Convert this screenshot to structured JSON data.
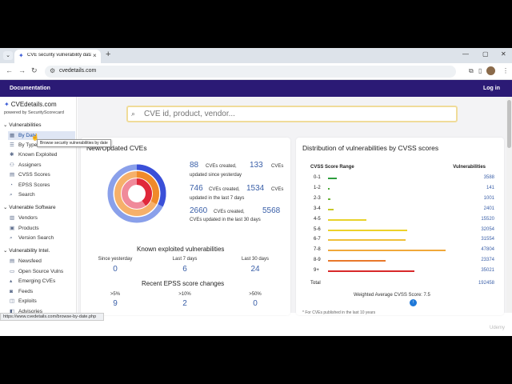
{
  "browser": {
    "tab_title": "CVE security vulnerability datab",
    "url": "cvedetails.com",
    "menu_chevron": "⌄",
    "new_tab": "+",
    "close": "×",
    "minimize": "—",
    "maximize": "▢",
    "win_close": "✕"
  },
  "nav": {
    "documentation": "Documentation",
    "login": "Log in"
  },
  "sidebar": {
    "logo": "CVEdetails.com",
    "powered": "powered by SecurityScorecard",
    "sections": [
      {
        "label": "Vulnerabilities",
        "items": [
          "By Date",
          "By Type",
          "Known Exploited",
          "Assigners",
          "CVSS Scores",
          "EPSS Scores",
          "Search"
        ]
      },
      {
        "label": "Vulnerable Software",
        "items": [
          "Vendors",
          "Products",
          "Version Search"
        ]
      },
      {
        "label": "Vulnerability Intel.",
        "items": [
          "Newsfeed",
          "Open Source Vulns",
          "Emerging CVEs",
          "Feeds",
          "Exploits",
          "Advisories"
        ]
      }
    ],
    "tooltip": "Browse security vulnerabilities by date",
    "status_url": "https://www.cvedetails.com/browse-by-date.php"
  },
  "search": {
    "placeholder": "CVE id, product, vendor..."
  },
  "new_cves": {
    "title": "New/Updated CVEs",
    "rows": [
      {
        "created": "88",
        "mid": "CVEs created,",
        "updated": "133",
        "end": "CVEs",
        "caption": "updated since yesterday"
      },
      {
        "created": "746",
        "mid": "CVEs created,",
        "updated": "1534",
        "end": "CVEs",
        "caption": "updated in the last 7 days"
      },
      {
        "created": "2660",
        "mid": "CVEs created,",
        "updated": "5568",
        "end": "",
        "caption": "CVEs updated in the last 30 days"
      }
    ],
    "donut": {
      "rings": [
        {
          "name": "outer",
          "created": 2660,
          "updated": 5568
        },
        {
          "name": "middle",
          "created": 746,
          "updated": 1534
        },
        {
          "name": "inner",
          "created": 88,
          "updated": 133
        }
      ],
      "colors": {
        "outer_a": "#3a4fd8",
        "outer_b": "#8aa0ea",
        "mid_a": "#f08a2a",
        "mid_b": "#f6b06a",
        "inner_a": "#e0283a",
        "inner_b": "#f08a9a"
      }
    },
    "known_exploited_title": "Known exploited vulnerabilities",
    "known_exploited": [
      {
        "label": "Since yesterday",
        "value": "0"
      },
      {
        "label": "Last 7 days",
        "value": "6"
      },
      {
        "label": "Last 30 days",
        "value": "24"
      }
    ],
    "epss_title": "Recent EPSS score changes",
    "epss": [
      {
        "label": ">5%",
        "value": "9"
      },
      {
        "label": ">10%",
        "value": "2"
      },
      {
        "label": ">50%",
        "value": "0"
      }
    ]
  },
  "cvss": {
    "title": "Distribution of vulnerabilities by CVSS scores",
    "header_range": "CVSS Score Range",
    "header_vulns": "Vulnerabilities",
    "rows": [
      {
        "range": "0-1",
        "value": "3588",
        "n": 3588,
        "color": "#2e9e3e"
      },
      {
        "range": "1-2",
        "value": "141",
        "n": 141,
        "color": "#4aa83a"
      },
      {
        "range": "2-3",
        "value": "1001",
        "n": 1001,
        "color": "#6ab23a"
      },
      {
        "range": "3-4",
        "value": "2401",
        "n": 2401,
        "color": "#c8c828"
      },
      {
        "range": "4-5",
        "value": "15520",
        "n": 15520,
        "color": "#e8d22a"
      },
      {
        "range": "5-6",
        "value": "32054",
        "n": 32054,
        "color": "#edd12a"
      },
      {
        "range": "6-7",
        "value": "31554",
        "n": 31554,
        "color": "#f0c03a"
      },
      {
        "range": "7-8",
        "value": "47804",
        "n": 47804,
        "color": "#f0a83a"
      },
      {
        "range": "8-9",
        "value": "23374",
        "n": 23374,
        "color": "#e8782a"
      },
      {
        "range": "9+",
        "value": "35021",
        "n": 35021,
        "color": "#d8282a"
      }
    ],
    "total_label": "Total",
    "total_value": "192458",
    "average": "Weighted Average CVSS Score: 7.5",
    "footnote": "* For CVEs published in the last 10 years"
  },
  "watermark": "Udemy"
}
